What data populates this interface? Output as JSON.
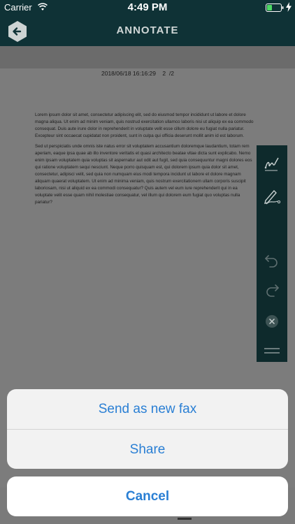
{
  "status_bar": {
    "carrier": "Carrier",
    "time": "4:49 PM"
  },
  "nav": {
    "title": "ANNOTATE",
    "back_icon": "arrow-left-icon"
  },
  "document": {
    "meta": "2018/06/18 16:16:29    2  /2",
    "paragraphs": [
      "Lorem ipsum dolor sit amet, consectetur adipiscing elit, sed do eiusmod tempor incididunt ut labore et dolore magna aliqua. Ut enim ad minim veniam, quis nostrud exercitation ullamco laboris nisi ut aliquip ex ea commodo consequat. Duis aute irure dolor in reprehenderit in voluptate velit esse cillum dolore eu fugiat nulla pariatur. Excepteur sint occaecat cupidatat non proident, sunt in culpa qui officia deserunt mollit anim id est laborum.",
      "Sed ut perspiciatis unde omnis iste natus error sit voluptatem accusantium doloremque laudantium, totam rem aperiam, eaque ipsa quae ab illo inventore veritatis et quasi architecto beatae vitae dicta sunt explicabo. Nemo enim ipsam voluptatem quia voluptas sit aspernatur aut odit aut fugit, sed quia consequuntur magni dolores eos qui ratione voluptatem sequi nesciunt. Neque porro quisquam est, qui dolorem ipsum quia dolor sit amet, consectetur, adipisci velit, sed quia non numquam eius modi tempora incidunt ut labore et dolore magnam aliquam quaerat voluptatem. Ut enim ad minima veniam, quis nostrum exercitationem ullam corporis suscipit laboriosam, nisi ut aliquid ex ea commodi consequatur? Quis autem vel eum iure reprehenderit qui in ea voluptate velit esse quam nihil molestiae consequatur, vel illum qui dolorem eum fugiat quo voluptas nulla pariatur?"
    ]
  },
  "toolbar": {
    "tools": [
      "signature-icon",
      "pen-icon",
      "undo-icon",
      "redo-icon",
      "close-icon",
      "menu-icon"
    ]
  },
  "action_sheet": {
    "send_as_new_fax": "Send as new fax",
    "share": "Share",
    "cancel": "Cancel"
  },
  "colors": {
    "nav_bg": "#0f3236",
    "accent": "#2a7fd4",
    "toolbar_bg": "#0e2a2c"
  }
}
